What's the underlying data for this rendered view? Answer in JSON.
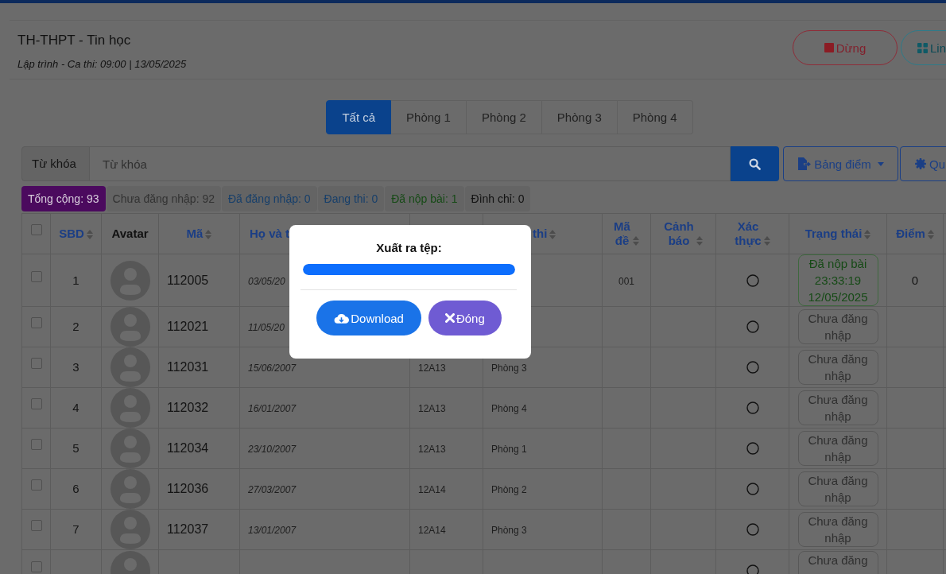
{
  "header": {
    "title": "TH-THPT - Tin học",
    "subtitle": "Lập trình - Ca thi: 09:00 | 13/05/2025",
    "buttons": [
      {
        "label": "Dừng",
        "kind": "stop"
      },
      {
        "label": "Lin",
        "kind": "grid"
      }
    ]
  },
  "tabs": [
    {
      "label": "Tất cả",
      "selected": true
    },
    {
      "label": "Phòng 1",
      "selected": false
    },
    {
      "label": "Phòng 2",
      "selected": false
    },
    {
      "label": "Phòng 3",
      "selected": false
    },
    {
      "label": "Phòng 4",
      "selected": false
    }
  ],
  "search": {
    "addon": "Từ khóa",
    "placeholder": "Từ khóa",
    "actions": [
      {
        "label": "Bảng điểm",
        "kind": "export",
        "dropdown": true
      },
      {
        "label": "Qu",
        "kind": "settings",
        "dropdown": false
      }
    ]
  },
  "badges": [
    {
      "label": "Tổng cộng: 93",
      "color": "#4b0a5e",
      "selected": true
    },
    {
      "label": "Chưa đăng nhập: 92",
      "color": "#333333",
      "selected": false
    },
    {
      "label": "Đã đăng nhập: 0",
      "color": "#173f6a",
      "selected": false
    },
    {
      "label": "Đang thi: 0",
      "color": "#173f6a",
      "selected": false
    },
    {
      "label": "Đã nộp bài: 1",
      "color": "#164a16",
      "selected": false
    },
    {
      "label": "Đình chỉ: 0",
      "color": "#111111",
      "selected": false
    }
  ],
  "table": {
    "select_all": {
      "checked": false
    },
    "columns": [
      {
        "label": "SBD",
        "sortable": true
      },
      {
        "label": "Avatar",
        "sortable": false
      },
      {
        "label": "Mã",
        "sortable": true
      },
      {
        "label": "Họ và t"
      },
      {
        "label": "thi",
        "sortable": true
      },
      {
        "label": "Mã đề",
        "sortable": true
      },
      {
        "label": "Cảnh báo",
        "sortable": true
      },
      {
        "label": "Xác thực",
        "sortable": true
      },
      {
        "label": "Trạng thái",
        "sortable": true
      },
      {
        "label": "Điểm",
        "sortable": true
      }
    ],
    "rows": [
      {
        "checked": false,
        "sbd": "1",
        "ma": "112005",
        "column_4": "03/05/20",
        "ma_de": "001",
        "verified": false,
        "status": {
          "kind": "submitted",
          "text": "Đã nộp bài 23:33:19 12/05/2025"
        },
        "diem": "0"
      },
      {
        "checked": false,
        "sbd": "2",
        "ma": "112021",
        "column_4": "11/05/20",
        "verified": false,
        "status": {
          "kind": "not_logged_in",
          "text": "Chưa đăng nhập"
        }
      },
      {
        "checked": false,
        "sbd": "3",
        "ma": "112031",
        "column_4": "15/06/2007",
        "column_5": "12A13",
        "column_6": "Phòng 3",
        "verified": false,
        "status": {
          "kind": "not_logged_in",
          "text": "Chưa đăng nhập"
        }
      },
      {
        "checked": false,
        "sbd": "4",
        "ma": "112032",
        "column_4": "16/01/2007",
        "column_5": "12A13",
        "column_6": "Phòng 4",
        "verified": false,
        "status": {
          "kind": "not_logged_in",
          "text": "Chưa đăng nhập"
        }
      },
      {
        "checked": false,
        "sbd": "5",
        "ma": "112034",
        "column_4": "23/10/2007",
        "column_5": "12A13",
        "column_6": "Phòng 1",
        "verified": false,
        "status": {
          "kind": "not_logged_in",
          "text": "Chưa đăng nhập"
        }
      },
      {
        "checked": false,
        "sbd": "6",
        "ma": "112036",
        "column_4": "27/03/2007",
        "column_5": "12A14",
        "column_6": "Phòng 2",
        "verified": false,
        "status": {
          "kind": "not_logged_in",
          "text": "Chưa đăng nhập"
        }
      },
      {
        "checked": false,
        "sbd": "7",
        "ma": "112037",
        "column_4": "13/01/2007",
        "column_5": "12A14",
        "column_6": "Phòng 3",
        "verified": false,
        "status": {
          "kind": "not_logged_in",
          "text": "Chưa đăng nhập"
        }
      },
      {
        "checked": false,
        "verified": false,
        "status": {
          "kind": "not_logged_in",
          "text": "Chưa đăng"
        }
      }
    ]
  },
  "modal": {
    "title": "Xuất ra tệp:",
    "progress": {
      "level": 1
    },
    "buttons": [
      {
        "label": "Download",
        "kind": "download"
      },
      {
        "label": "Đóng",
        "kind": "close"
      }
    ]
  }
}
